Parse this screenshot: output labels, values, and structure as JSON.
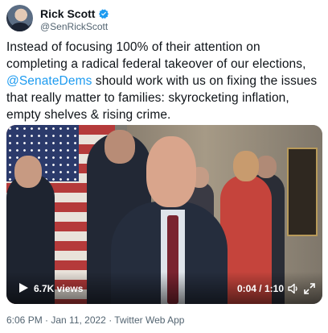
{
  "author": {
    "display_name": "Rick Scott",
    "handle": "@SenRickScott",
    "verified": true
  },
  "tweet": {
    "text_part1": "Instead of focusing 100% of their attention on completing a radical federal takeover of our elections, ",
    "mention": "@SenateDems",
    "text_part2": " should work with us on fixing the issues that really matter to families: skyrocketing inflation, empty shelves & rising crime."
  },
  "video": {
    "views": "6.7K views",
    "time": "0:04 / 1:10"
  },
  "meta": {
    "timestamp": "6:06 PM · Jan 11, 2022 · Twitter Web App"
  },
  "colors": {
    "accent": "#1d9bf0",
    "text": "#0f1419",
    "secondary": "#536471"
  },
  "icons": [
    "verified-badge-icon",
    "play-icon",
    "volume-icon",
    "expand-icon"
  ]
}
